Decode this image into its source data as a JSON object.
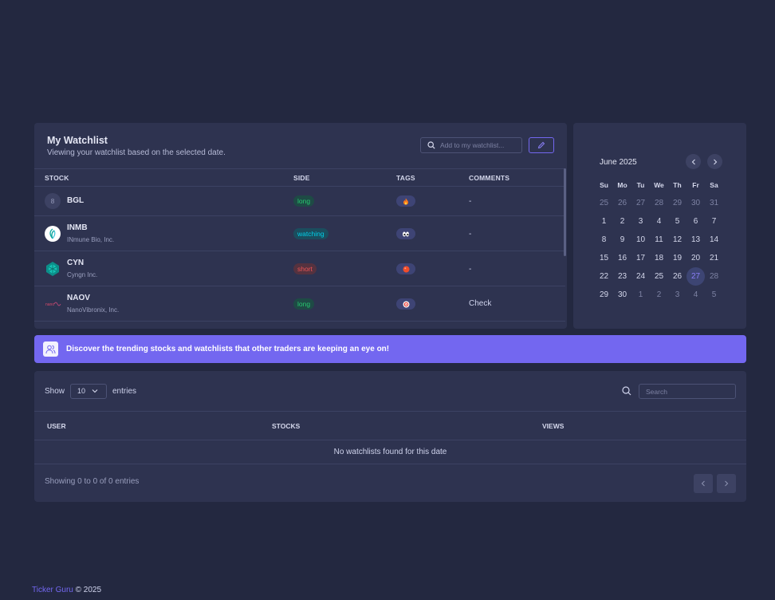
{
  "watchlist": {
    "title": "My Watchlist",
    "subtitle": "Viewing your watchlist based on the selected date.",
    "search_placeholder": "Add to my watchlist...",
    "columns": [
      "STOCK",
      "SIDE",
      "TAGS",
      "COMMENTS"
    ],
    "rows": [
      {
        "logo": "8",
        "ticker": "BGL",
        "company": "",
        "side": "long",
        "tag_icon": "fire-icon",
        "comment": "-"
      },
      {
        "logo": "",
        "ticker": "INMB",
        "company": "INmune Bio, Inc.",
        "side": "watching",
        "tag_icon": "eyes-icon",
        "comment": "-"
      },
      {
        "logo": "",
        "ticker": "CYN",
        "company": "Cyngn Inc.",
        "side": "short",
        "tag_icon": "red-circle-icon",
        "comment": "-"
      },
      {
        "logo": "",
        "ticker": "NAOV",
        "company": "NanoVibronix, Inc.",
        "side": "long",
        "tag_icon": "target-icon",
        "comment": "Check"
      }
    ]
  },
  "calendar": {
    "title": "June 2025",
    "dow": [
      "Su",
      "Mo",
      "Tu",
      "We",
      "Th",
      "Fr",
      "Sa"
    ],
    "weeks": [
      [
        "25",
        "26",
        "27",
        "28",
        "29",
        "30",
        "31"
      ],
      [
        "1",
        "2",
        "3",
        "4",
        "5",
        "6",
        "7"
      ],
      [
        "8",
        "9",
        "10",
        "11",
        "12",
        "13",
        "14"
      ],
      [
        "15",
        "16",
        "17",
        "18",
        "19",
        "20",
        "21"
      ],
      [
        "22",
        "23",
        "24",
        "25",
        "26",
        "27",
        "28"
      ],
      [
        "29",
        "30",
        "1",
        "2",
        "3",
        "4",
        "5"
      ]
    ],
    "selected": "27"
  },
  "banner": {
    "text": "Discover the trending stocks and watchlists that other traders are keeping an eye on!"
  },
  "trending": {
    "show_label": "Show",
    "page_size": "10",
    "entries_label": "entries",
    "search_placeholder": "Search",
    "columns": [
      "USER",
      "STOCKS",
      "VIEWS"
    ],
    "empty_text": "No watchlists found for this date",
    "info": "Showing 0 to 0 of 0 entries"
  },
  "footer": {
    "brand": "Ticker Guru",
    "copyright": "© 2025"
  },
  "colors": {
    "background": "#232840",
    "card": "#2e3350",
    "accent": "#7367f0",
    "long": "#28c76f",
    "watching": "#00cfe8",
    "short": "#ea5455"
  }
}
